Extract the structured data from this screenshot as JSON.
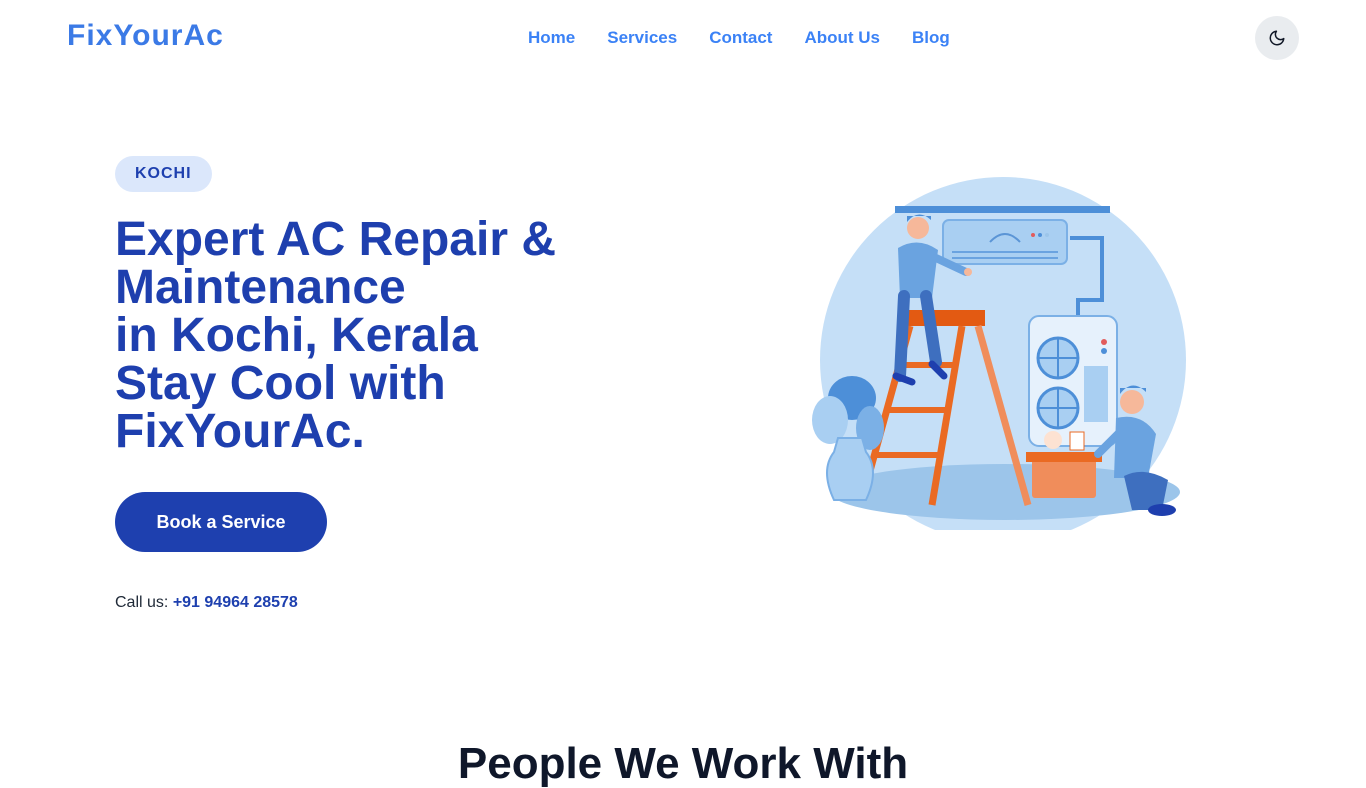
{
  "header": {
    "logo": "FixYourAc",
    "nav": [
      {
        "label": "Home"
      },
      {
        "label": "Services"
      },
      {
        "label": "Contact"
      },
      {
        "label": "About Us"
      },
      {
        "label": "Blog"
      }
    ],
    "theme_toggle_icon": "moon-icon"
  },
  "hero": {
    "badge": "KOCHI",
    "headline_lines": [
      "Expert AC Repair &",
      "Maintenance",
      "in Kochi, Kerala",
      "Stay Cool with",
      "FixYourAc."
    ],
    "cta_label": "Book a Service",
    "call_prefix": "Call us:",
    "phone": "+91 94964 28578",
    "illustration_icon": "ac-technicians-illustration"
  },
  "next_section": {
    "title_partial": "People We Work With"
  },
  "colors": {
    "brand": "#3b7ae6",
    "primary": "#1e40af",
    "nav_link": "#3b82f6",
    "badge_bg": "#dbe7fb"
  }
}
